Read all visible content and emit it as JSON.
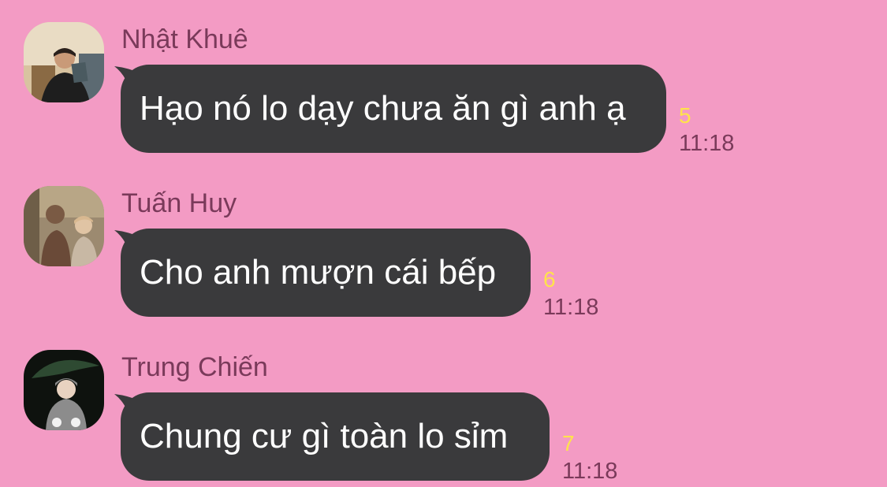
{
  "messages": [
    {
      "sender": "Nhật Khuê",
      "text": "Hạo nó lo dạy chưa ăn gì anh ạ",
      "read_count": "5",
      "time": "11:18"
    },
    {
      "sender": "Tuấn Huy",
      "text": "Cho anh mượn cái bếp",
      "read_count": "6",
      "time": "11:18"
    },
    {
      "sender": "Trung Chiến",
      "text": "Chung cư gì toàn lo sỉm",
      "read_count": "7",
      "time": "11:18"
    }
  ],
  "colors": {
    "background": "#f39bc4",
    "bubble": "#3a3a3c",
    "bubble_text": "#ffffff",
    "sender_name": "#7a3a5a",
    "read_count": "#ffe34a"
  }
}
